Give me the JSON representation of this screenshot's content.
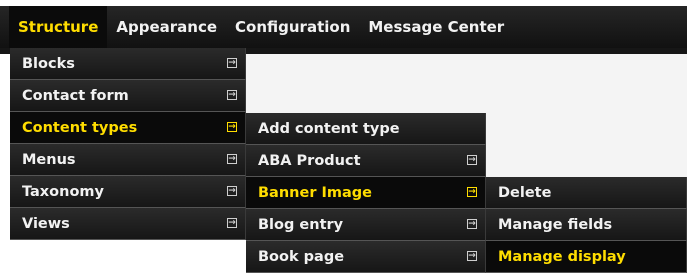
{
  "top_nav": {
    "items": [
      {
        "label": "Structure",
        "active": true
      },
      {
        "label": "Appearance",
        "active": false
      },
      {
        "label": "Configuration",
        "active": false
      },
      {
        "label": "Message Center",
        "active": false
      }
    ]
  },
  "menu_level1": {
    "items": [
      {
        "label": "Blocks",
        "active": false
      },
      {
        "label": "Contact form",
        "active": false
      },
      {
        "label": "Content types",
        "active": true
      },
      {
        "label": "Menus",
        "active": false
      },
      {
        "label": "Taxonomy",
        "active": false
      },
      {
        "label": "Views",
        "active": false
      }
    ]
  },
  "menu_level2": {
    "items": [
      {
        "label": "Add content type",
        "active": false
      },
      {
        "label": "ABA Product",
        "active": false
      },
      {
        "label": "Banner Image",
        "active": true
      },
      {
        "label": "Blog entry",
        "active": false
      },
      {
        "label": "Book page",
        "active": false
      }
    ]
  },
  "menu_level3": {
    "items": [
      {
        "label": "Delete",
        "active": false
      },
      {
        "label": "Manage fields",
        "active": false
      },
      {
        "label": "Manage display",
        "active": true
      }
    ]
  },
  "colors": {
    "active_text": "#ffdd00",
    "menu_bg": "#222222",
    "active_bg": "#0a0a0a"
  },
  "icons": {
    "submenu_arrow": "expand-arrow-icon"
  }
}
